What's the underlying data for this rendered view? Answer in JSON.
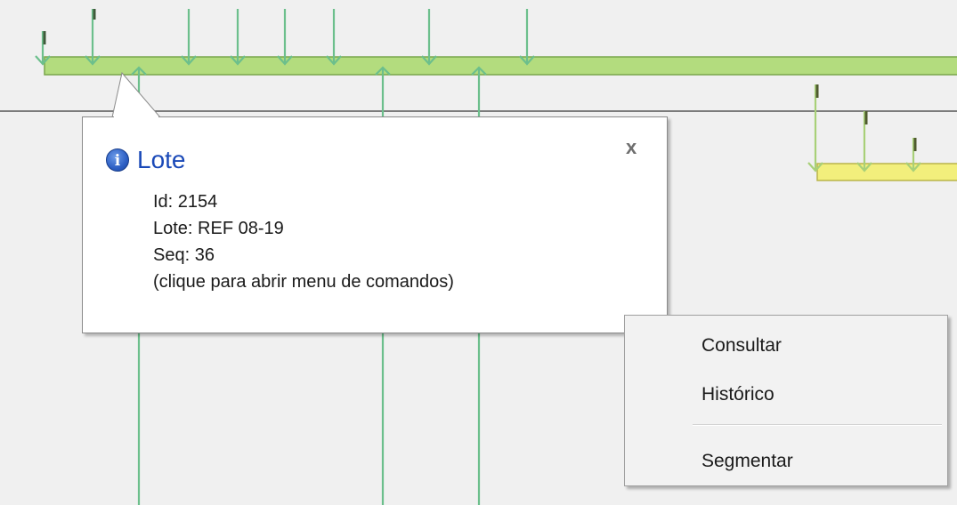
{
  "tooltip": {
    "icon": "info-icon",
    "title": "Lote",
    "close_label": "x",
    "id_line": "Id: 2154",
    "lote_line": "Lote: REF 08-19",
    "seq_line": "Seq: 36",
    "hint_line": "(clique para abrir menu de comandos)"
  },
  "context_menu": {
    "items": [
      {
        "label": "Consultar"
      },
      {
        "label": "Histórico"
      },
      {
        "label": "Segmentar"
      }
    ]
  },
  "colors": {
    "background": "#f0f0f0",
    "green_bar": "#b3dc7e",
    "yellow_bar": "#f2ef7c",
    "connector": "#6cbf8c",
    "title_blue": "#1a49b8"
  }
}
